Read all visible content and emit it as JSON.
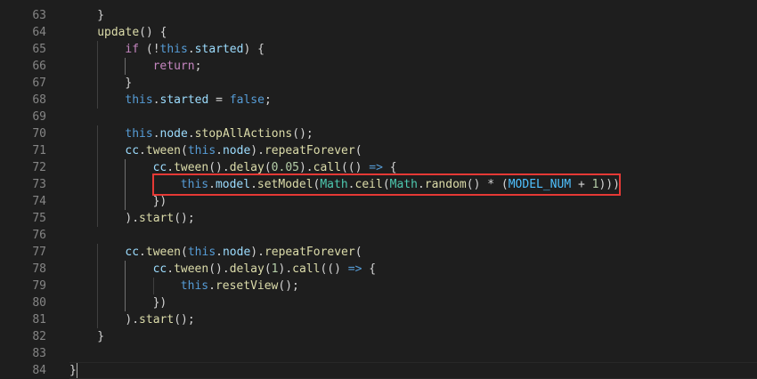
{
  "editor": {
    "lines": [
      {
        "num": "63",
        "indent": 1,
        "tokens": [
          {
            "t": "}",
            "c": "punct"
          }
        ]
      },
      {
        "num": "64",
        "indent": 1,
        "tokens": [
          {
            "t": "update",
            "c": "fn"
          },
          {
            "t": "() {",
            "c": "punct"
          }
        ]
      },
      {
        "num": "65",
        "indent": 2,
        "tokens": [
          {
            "t": "if",
            "c": "kw"
          },
          {
            "t": " (!",
            "c": "punct"
          },
          {
            "t": "this",
            "c": "this"
          },
          {
            "t": ".",
            "c": "punct"
          },
          {
            "t": "started",
            "c": "prop"
          },
          {
            "t": ") {",
            "c": "punct"
          }
        ]
      },
      {
        "num": "66",
        "indent": 3,
        "tokens": [
          {
            "t": "return",
            "c": "kw"
          },
          {
            "t": ";",
            "c": "punct"
          }
        ]
      },
      {
        "num": "67",
        "indent": 2,
        "tokens": [
          {
            "t": "}",
            "c": "punct"
          }
        ]
      },
      {
        "num": "68",
        "indent": 2,
        "tokens": [
          {
            "t": "this",
            "c": "this"
          },
          {
            "t": ".",
            "c": "punct"
          },
          {
            "t": "started",
            "c": "prop"
          },
          {
            "t": " = ",
            "c": "op"
          },
          {
            "t": "false",
            "c": "bool"
          },
          {
            "t": ";",
            "c": "punct"
          }
        ]
      },
      {
        "num": "69",
        "indent": 0,
        "tokens": []
      },
      {
        "num": "70",
        "indent": 2,
        "tokens": [
          {
            "t": "this",
            "c": "this"
          },
          {
            "t": ".",
            "c": "punct"
          },
          {
            "t": "node",
            "c": "prop"
          },
          {
            "t": ".",
            "c": "punct"
          },
          {
            "t": "stopAllActions",
            "c": "fn"
          },
          {
            "t": "();",
            "c": "punct"
          }
        ]
      },
      {
        "num": "71",
        "indent": 2,
        "tokens": [
          {
            "t": "cc",
            "c": "var"
          },
          {
            "t": ".",
            "c": "punct"
          },
          {
            "t": "tween",
            "c": "fn"
          },
          {
            "t": "(",
            "c": "punct"
          },
          {
            "t": "this",
            "c": "this"
          },
          {
            "t": ".",
            "c": "punct"
          },
          {
            "t": "node",
            "c": "prop"
          },
          {
            "t": ").",
            "c": "punct"
          },
          {
            "t": "repeatForever",
            "c": "fn"
          },
          {
            "t": "(",
            "c": "punct"
          }
        ]
      },
      {
        "num": "72",
        "indent": 3,
        "tokens": [
          {
            "t": "cc",
            "c": "var"
          },
          {
            "t": ".",
            "c": "punct"
          },
          {
            "t": "tween",
            "c": "fn"
          },
          {
            "t": "().",
            "c": "punct"
          },
          {
            "t": "delay",
            "c": "fn"
          },
          {
            "t": "(",
            "c": "punct"
          },
          {
            "t": "0.05",
            "c": "num"
          },
          {
            "t": ").",
            "c": "punct"
          },
          {
            "t": "call",
            "c": "fn"
          },
          {
            "t": "(() ",
            "c": "punct"
          },
          {
            "t": "=>",
            "c": "arrow"
          },
          {
            "t": " {",
            "c": "punct"
          }
        ]
      },
      {
        "num": "73",
        "indent": 4,
        "tokens": [
          {
            "t": "this",
            "c": "this"
          },
          {
            "t": ".",
            "c": "punct"
          },
          {
            "t": "model",
            "c": "prop"
          },
          {
            "t": ".",
            "c": "punct"
          },
          {
            "t": "setModel",
            "c": "fn"
          },
          {
            "t": "(",
            "c": "punct"
          },
          {
            "t": "Math",
            "c": "cls"
          },
          {
            "t": ".",
            "c": "punct"
          },
          {
            "t": "ceil",
            "c": "fn"
          },
          {
            "t": "(",
            "c": "punct"
          },
          {
            "t": "Math",
            "c": "cls"
          },
          {
            "t": ".",
            "c": "punct"
          },
          {
            "t": "random",
            "c": "fn"
          },
          {
            "t": "() * (",
            "c": "punct"
          },
          {
            "t": "MODEL_NUM",
            "c": "const"
          },
          {
            "t": " + ",
            "c": "op"
          },
          {
            "t": "1",
            "c": "num"
          },
          {
            "t": ")))",
            "c": "punct"
          }
        ]
      },
      {
        "num": "74",
        "indent": 3,
        "tokens": [
          {
            "t": "})",
            "c": "punct"
          }
        ]
      },
      {
        "num": "75",
        "indent": 2,
        "tokens": [
          {
            "t": ").",
            "c": "punct"
          },
          {
            "t": "start",
            "c": "fn"
          },
          {
            "t": "();",
            "c": "punct"
          }
        ]
      },
      {
        "num": "76",
        "indent": 0,
        "tokens": []
      },
      {
        "num": "77",
        "indent": 2,
        "tokens": [
          {
            "t": "cc",
            "c": "var"
          },
          {
            "t": ".",
            "c": "punct"
          },
          {
            "t": "tween",
            "c": "fn"
          },
          {
            "t": "(",
            "c": "punct"
          },
          {
            "t": "this",
            "c": "this"
          },
          {
            "t": ".",
            "c": "punct"
          },
          {
            "t": "node",
            "c": "prop"
          },
          {
            "t": ").",
            "c": "punct"
          },
          {
            "t": "repeatForever",
            "c": "fn"
          },
          {
            "t": "(",
            "c": "punct"
          }
        ]
      },
      {
        "num": "78",
        "indent": 3,
        "tokens": [
          {
            "t": "cc",
            "c": "var"
          },
          {
            "t": ".",
            "c": "punct"
          },
          {
            "t": "tween",
            "c": "fn"
          },
          {
            "t": "().",
            "c": "punct"
          },
          {
            "t": "delay",
            "c": "fn"
          },
          {
            "t": "(",
            "c": "punct"
          },
          {
            "t": "1",
            "c": "num"
          },
          {
            "t": ").",
            "c": "punct"
          },
          {
            "t": "call",
            "c": "fn"
          },
          {
            "t": "(() ",
            "c": "punct"
          },
          {
            "t": "=>",
            "c": "arrow"
          },
          {
            "t": " {",
            "c": "punct"
          }
        ]
      },
      {
        "num": "79",
        "indent": 4,
        "tokens": [
          {
            "t": "this",
            "c": "this"
          },
          {
            "t": ".",
            "c": "punct"
          },
          {
            "t": "resetView",
            "c": "fn"
          },
          {
            "t": "();",
            "c": "punct"
          }
        ]
      },
      {
        "num": "80",
        "indent": 3,
        "tokens": [
          {
            "t": "})",
            "c": "punct"
          }
        ]
      },
      {
        "num": "81",
        "indent": 2,
        "tokens": [
          {
            "t": ").",
            "c": "punct"
          },
          {
            "t": "start",
            "c": "fn"
          },
          {
            "t": "();",
            "c": "punct"
          }
        ]
      },
      {
        "num": "82",
        "indent": 1,
        "tokens": [
          {
            "t": "}",
            "c": "punct"
          }
        ]
      },
      {
        "num": "83",
        "indent": 0,
        "tokens": []
      },
      {
        "num": "84",
        "indent": 0,
        "tokens": [
          {
            "t": "}",
            "c": "punct"
          }
        ]
      }
    ],
    "highlighted_line": "73",
    "current_line": "84",
    "colors": {
      "background": "#1e1e1e",
      "line_number": "#858585",
      "keyword": "#c586c0",
      "function": "#dcdcaa",
      "property": "#9cdcfe",
      "class": "#4ec9b0",
      "number": "#b5cea8",
      "highlight_border": "#e53935"
    }
  }
}
